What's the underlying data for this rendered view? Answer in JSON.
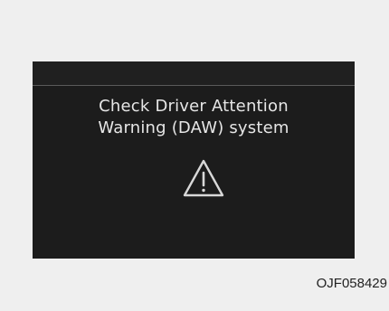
{
  "display": {
    "message_line1": "Check Driver Attention",
    "message_line2": "Warning (DAW) system",
    "icon": "warning-triangle-icon"
  },
  "figure_code": "OJF058429",
  "colors": {
    "background": "#efefef",
    "panel": "#1c1c1c",
    "text": "#e6e6e6",
    "divider": "#5a5a5a"
  }
}
